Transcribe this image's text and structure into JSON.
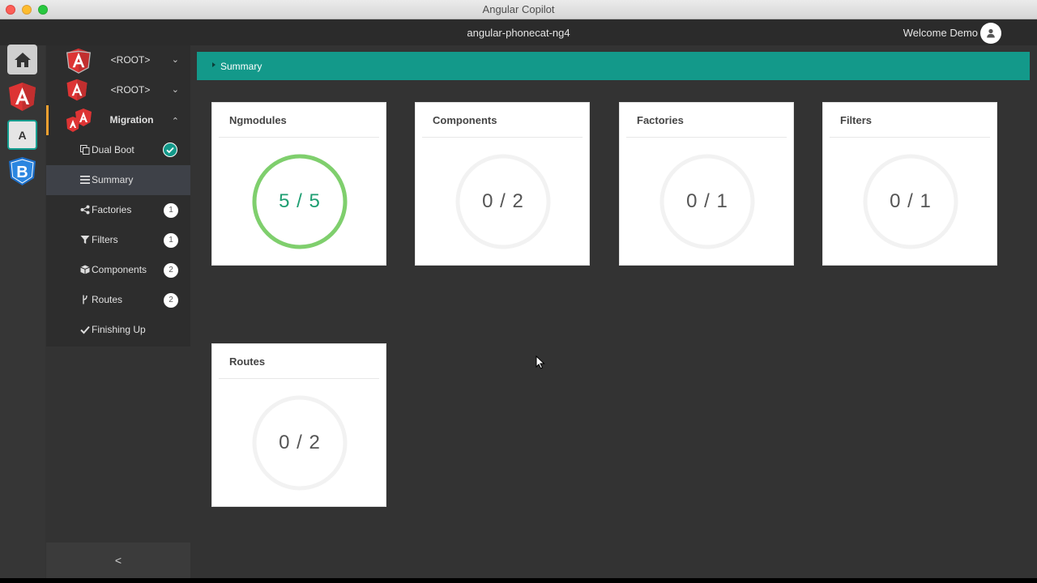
{
  "window": {
    "title": "Angular Copilot"
  },
  "header": {
    "project": "angular-phonecat-ng4",
    "welcome": "Welcome Demo"
  },
  "sidebar": {
    "projects": [
      {
        "label": "<ROOT>",
        "chevron": "chevron-down-icon"
      },
      {
        "label": "<ROOT>",
        "chevron": "chevron-down-icon"
      },
      {
        "label": "Migration",
        "chevron": "chevron-up-icon"
      }
    ],
    "items": [
      {
        "label": "Dual Boot",
        "icon": "copy-icon",
        "status": "complete"
      },
      {
        "label": "Summary",
        "icon": "list-icon",
        "selected": true
      },
      {
        "label": "Factories",
        "icon": "share-icon",
        "badge": "1"
      },
      {
        "label": "Filters",
        "icon": "filter-icon",
        "badge": "1"
      },
      {
        "label": "Components",
        "icon": "cube-icon",
        "badge": "2"
      },
      {
        "label": "Routes",
        "icon": "fork-icon",
        "badge": "2"
      },
      {
        "label": "Finishing Up",
        "icon": "check-icon"
      }
    ],
    "collapse_label": "<"
  },
  "summary": {
    "label": "Summary",
    "accent": "#13998a"
  },
  "cards": [
    {
      "title": "Ngmodules",
      "done": 5,
      "total": 5,
      "text": "5 / 5"
    },
    {
      "title": "Components",
      "done": 0,
      "total": 2,
      "text": "0 / 2"
    },
    {
      "title": "Factories",
      "done": 0,
      "total": 1,
      "text": "0 / 1"
    },
    {
      "title": "Filters",
      "done": 0,
      "total": 1,
      "text": "0 / 1"
    },
    {
      "title": "Routes",
      "done": 0,
      "total": 2,
      "text": "0 / 2"
    }
  ],
  "colors": {
    "progress": "#7fcf6d",
    "track": "#f2f2f2",
    "done_text": "#1d9e71"
  }
}
